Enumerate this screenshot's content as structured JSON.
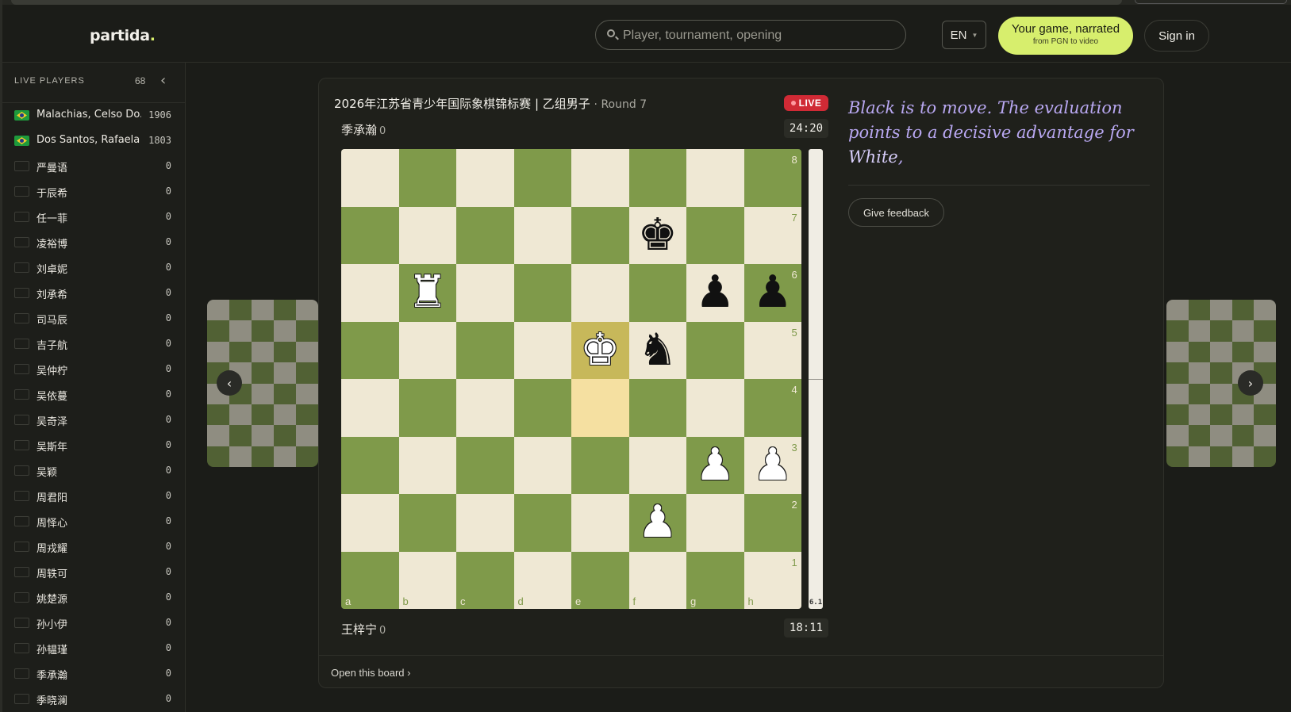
{
  "header": {
    "logo": "partida",
    "logo_dot": ".",
    "search_placeholder": "Player, tournament, opening",
    "lang": "EN",
    "narrate_title": "Your game, narrated",
    "narrate_sub": "from PGN to video",
    "signin": "Sign in"
  },
  "sidebar": {
    "title": "LIVE PLAYERS",
    "count": "68",
    "players": [
      {
        "name": "Malachias, Celso Do...",
        "rating": "1906",
        "flag": "br"
      },
      {
        "name": "Dos Santos, Rafaela ...",
        "rating": "1803",
        "flag": "br"
      },
      {
        "name": "严曼语",
        "rating": "0",
        "flag": ""
      },
      {
        "name": "于辰希",
        "rating": "0",
        "flag": ""
      },
      {
        "name": "任一菲",
        "rating": "0",
        "flag": ""
      },
      {
        "name": "凌裕博",
        "rating": "0",
        "flag": ""
      },
      {
        "name": "刘卓妮",
        "rating": "0",
        "flag": ""
      },
      {
        "name": "刘承希",
        "rating": "0",
        "flag": ""
      },
      {
        "name": "司马辰",
        "rating": "0",
        "flag": ""
      },
      {
        "name": "吉子航",
        "rating": "0",
        "flag": ""
      },
      {
        "name": "吴仲柠",
        "rating": "0",
        "flag": ""
      },
      {
        "name": "吴依蔓",
        "rating": "0",
        "flag": ""
      },
      {
        "name": "吴奇泽",
        "rating": "0",
        "flag": ""
      },
      {
        "name": "吴斯年",
        "rating": "0",
        "flag": ""
      },
      {
        "name": "吴颖",
        "rating": "0",
        "flag": ""
      },
      {
        "name": "周君阳",
        "rating": "0",
        "flag": ""
      },
      {
        "name": "周怿心",
        "rating": "0",
        "flag": ""
      },
      {
        "name": "周戎耀",
        "rating": "0",
        "flag": ""
      },
      {
        "name": "周轶可",
        "rating": "0",
        "flag": ""
      },
      {
        "name": "姚楚源",
        "rating": "0",
        "flag": ""
      },
      {
        "name": "孙小伊",
        "rating": "0",
        "flag": ""
      },
      {
        "name": "孙韫瑾",
        "rating": "0",
        "flag": ""
      },
      {
        "name": "季承瀚",
        "rating": "0",
        "flag": ""
      },
      {
        "name": "季晓澜",
        "rating": "0",
        "flag": ""
      }
    ]
  },
  "game": {
    "event": "2026年江苏省青少年国际象棋锦标赛 | 乙组男子",
    "round": "· Round 7",
    "live": "LIVE",
    "top_player": "季承瀚",
    "top_score": "0",
    "top_clock": "24:20",
    "bottom_player": "王梓宁",
    "bottom_score": "0",
    "bottom_clock": "18:11",
    "eval": "6.1",
    "eval_white_fraction": 0.5,
    "ranks": [
      "8",
      "7",
      "6",
      "5",
      "4",
      "3",
      "2",
      "1"
    ],
    "files": [
      "a",
      "b",
      "c",
      "d",
      "e",
      "f",
      "g",
      "h"
    ],
    "pieces": [
      {
        "square": "f7",
        "glyph": "♚",
        "color": "b",
        "name": "black-king"
      },
      {
        "square": "b6",
        "glyph": "♜",
        "color": "w",
        "name": "white-rook"
      },
      {
        "square": "g6",
        "glyph": "♟",
        "color": "b",
        "name": "black-pawn"
      },
      {
        "square": "h6",
        "glyph": "♟",
        "color": "b",
        "name": "black-pawn"
      },
      {
        "square": "e5",
        "glyph": "♚",
        "color": "w",
        "name": "white-king"
      },
      {
        "square": "f5",
        "glyph": "♞",
        "color": "b",
        "name": "black-knight"
      },
      {
        "square": "g3",
        "glyph": "♟",
        "color": "w",
        "name": "white-pawn"
      },
      {
        "square": "h3",
        "glyph": "♟",
        "color": "w",
        "name": "white-pawn"
      },
      {
        "square": "f2",
        "glyph": "♟",
        "color": "w",
        "name": "white-pawn"
      }
    ],
    "highlight_from": "e4",
    "highlight_to": "e5",
    "commentary_a": "Black is to move. The evaluation points to a decisive advantage for ",
    "commentary_b": "White",
    "commentary_c": ",",
    "feedback": "Give feedback",
    "open_board": "Open this board ›"
  },
  "nav": {
    "prev": "‹",
    "next": "›",
    "mute": "🔇"
  },
  "colors": {
    "accent": "#d7ee6d",
    "live": "#d02a35",
    "board_light": "#efe8d4",
    "board_dark": "#7f9a4a"
  }
}
